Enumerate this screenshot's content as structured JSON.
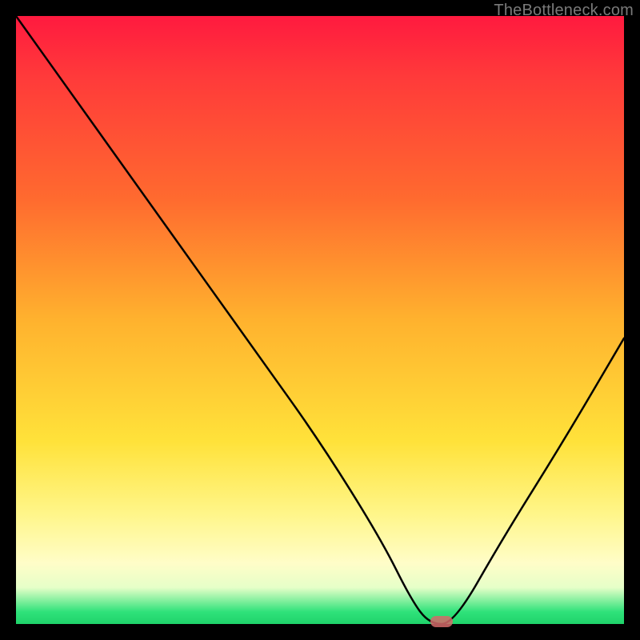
{
  "watermark": "TheBottleneck.com",
  "chart_data": {
    "type": "line",
    "title": "",
    "xlabel": "",
    "ylabel": "",
    "xlim": [
      0,
      100
    ],
    "ylim": [
      0,
      100
    ],
    "grid": false,
    "legend": false,
    "background_gradient": {
      "top": "#ff1a3f",
      "mid_upper": "#ff6a2f",
      "mid": "#ffe23a",
      "mid_lower": "#fffdc8",
      "bottom": "#1fd36a"
    },
    "series": [
      {
        "name": "bottleneck-curve",
        "x": [
          0,
          10,
          20,
          30,
          40,
          50,
          60,
          65,
          68,
          72,
          80,
          90,
          100
        ],
        "values": [
          100,
          86,
          72,
          58,
          44,
          30,
          14,
          4,
          0,
          0,
          14,
          30,
          47
        ]
      }
    ],
    "marker": {
      "name": "optimum-marker",
      "x": 70,
      "y": 0,
      "color": "#d46a6a"
    }
  }
}
